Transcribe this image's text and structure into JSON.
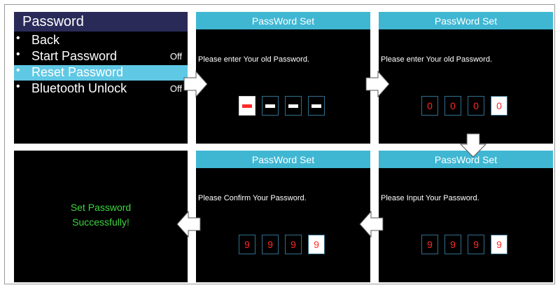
{
  "menu": {
    "title": "Password",
    "items": [
      {
        "label": "Back",
        "value": ""
      },
      {
        "label": "Start Password",
        "value": "Off"
      },
      {
        "label": "Reset Password",
        "value": ""
      },
      {
        "label": "Bluetooth Unlock",
        "value": "Off"
      }
    ],
    "selected_item": "Reset Password",
    "bullet": "•"
  },
  "screens": {
    "old_entry": {
      "title": "PassWord Set",
      "prompt": "Please enter Your old Password.",
      "digits": [
        "",
        "",
        "",
        ""
      ]
    },
    "old_filled": {
      "title": "PassWord Set",
      "prompt": "Please enter Your old Password.",
      "digits": [
        "0",
        "0",
        "0",
        "0"
      ]
    },
    "new_input": {
      "title": "PassWord Set",
      "prompt": "Please Input Your Password.",
      "digits": [
        "9",
        "9",
        "9",
        "9"
      ]
    },
    "confirm": {
      "title": "PassWord Set",
      "prompt": "Please Confirm Your Password.",
      "digits": [
        "9",
        "9",
        "9",
        "9"
      ]
    },
    "success": {
      "line1": "Set Password",
      "line2": "Successfully!"
    }
  },
  "colors": {
    "menu_header": "#2a2a59",
    "selected": "#5fc8e4",
    "title_bar": "#3fb7d3",
    "digit": "#ff2a2a",
    "success_text": "#3dd63d"
  },
  "icons": [
    "arrow-right-icon",
    "arrow-down-icon",
    "arrow-left-icon"
  ]
}
